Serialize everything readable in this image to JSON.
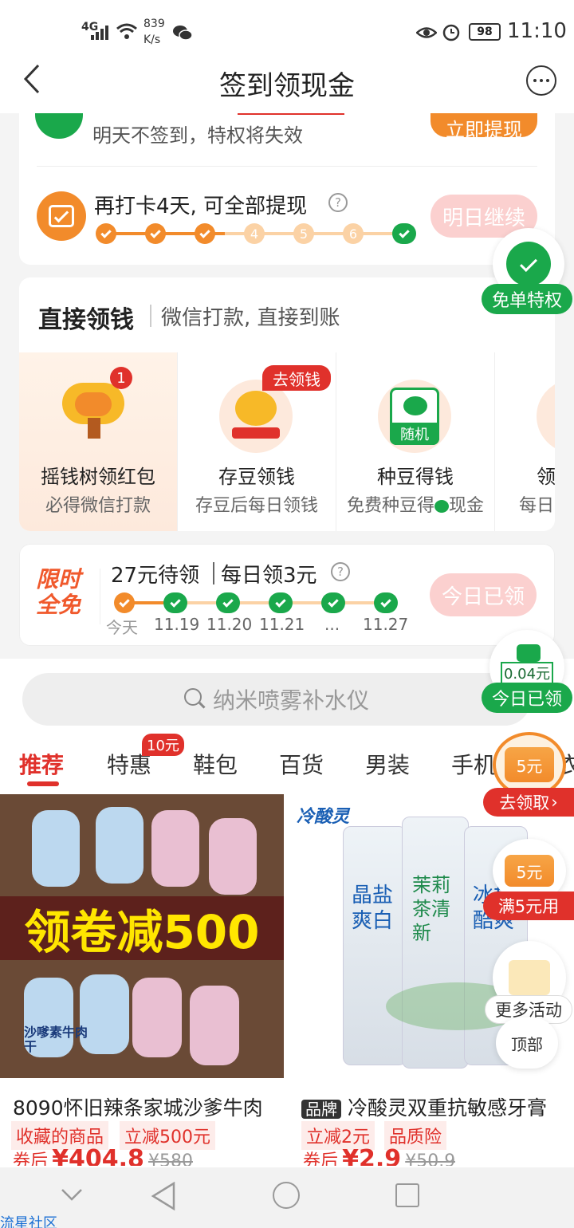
{
  "status_bar": {
    "network": "4G",
    "speed_value": "839",
    "speed_unit": "K/s",
    "battery": "98",
    "time": "11:10"
  },
  "header": {
    "title": "签到领现金"
  },
  "signin_card": {
    "warning": "明天不签到，特权将失效",
    "withdraw_button": "立即提现",
    "progress_title": "再打卡4天, 可全部提现",
    "steps": [
      "4",
      "5",
      "6"
    ],
    "continue_button": "明日继续"
  },
  "side_badges": {
    "free_privilege": "免单特权",
    "today_amount": "0.04元",
    "today_done": "今日已领",
    "coupon_value": "5元",
    "go_claim": "去领取",
    "coupon2_value": "5元",
    "full_use": "满5元用",
    "more": "更多活动",
    "top": "顶部"
  },
  "direct_money": {
    "title": "直接领钱",
    "subtitle": "微信打款, 直接到账",
    "items": [
      {
        "name": "摇钱树领红包",
        "desc": "必得微信打款",
        "badge": "1"
      },
      {
        "name": "存豆领钱",
        "desc": "存豆后每日领钱",
        "tag": "去领钱"
      },
      {
        "name": "种豆得钱",
        "desc_a": "免费种豆得",
        "desc_b": "现金",
        "icon_label": "随机"
      },
      {
        "name": "领",
        "desc": "每日"
      }
    ]
  },
  "limited_free": {
    "logo_line1": "限时",
    "logo_line2": "全免",
    "pending": "27元待领",
    "daily": "每日领3元",
    "button": "今日已领",
    "dates": [
      "今天",
      "11.19",
      "11.20",
      "11.21",
      "...",
      "11.27"
    ]
  },
  "search": {
    "placeholder": "纳米喷雾补水仪"
  },
  "tabs": [
    {
      "label": "推荐"
    },
    {
      "label": "特惠",
      "badge": "10元"
    },
    {
      "label": "鞋包"
    },
    {
      "label": "百货"
    },
    {
      "label": "男装"
    },
    {
      "label": "手机"
    },
    {
      "label": "衣"
    }
  ],
  "products": [
    {
      "title": "8090怀旧辣条家城沙爹牛肉",
      "tags": [
        "收藏的商品",
        "立减500元"
      ],
      "price_prefix": "券后",
      "price": "¥404.8",
      "orig": "¥580",
      "banner": "领卷减500",
      "bag_text": "沙嗲素牛肉干"
    },
    {
      "brand_tag": "品牌",
      "title": "冷酸灵双重抗敏感牙膏",
      "tags": [
        "立减2元",
        "品质险"
      ],
      "price_prefix": "券后",
      "price": "¥2.9",
      "orig": "¥50.9",
      "logo": "冷酸灵",
      "tube_labels": [
        "晶盐爽白",
        "茉莉茶清新",
        "冰柠酷爽"
      ]
    }
  ],
  "watermark": "流星社区"
}
